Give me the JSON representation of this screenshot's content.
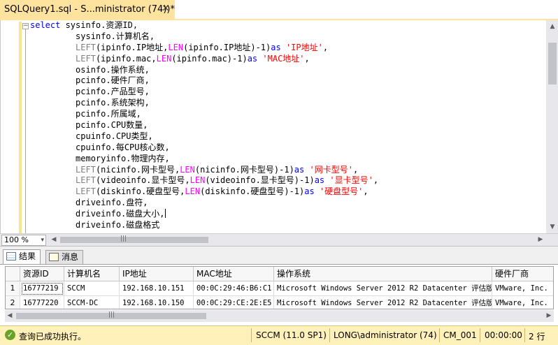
{
  "tab": {
    "title": "SQLQuery1.sql - S...ministrator (74))*",
    "close": "✕"
  },
  "editor": {
    "collapse": "−",
    "lines": [
      [
        [
          "kw",
          "select "
        ],
        [
          "",
          "sysinfo.资源ID,"
        ]
      ],
      [
        [
          "",
          "         sysinfo.计算机名,"
        ]
      ],
      [
        [
          "",
          "         "
        ],
        [
          "gray",
          "LEFT"
        ],
        [
          "",
          "(ipinfo.IP地址,"
        ],
        [
          "fn",
          "LEN"
        ],
        [
          "",
          "(ipinfo.IP地址)-1)"
        ],
        [
          "kw",
          "as "
        ],
        [
          "str",
          "'IP地址'"
        ],
        [
          "",
          ","
        ]
      ],
      [
        [
          "",
          "         "
        ],
        [
          "gray",
          "LEFT"
        ],
        [
          "",
          "(ipinfo.mac,"
        ],
        [
          "fn",
          "LEN"
        ],
        [
          "",
          "(ipinfo.mac)-1)"
        ],
        [
          "kw",
          "as "
        ],
        [
          "str",
          "'MAC地址'"
        ],
        [
          "",
          ","
        ]
      ],
      [
        [
          "",
          "         osinfo.操作系统,"
        ]
      ],
      [
        [
          "",
          "         pcinfo.硬件厂商,"
        ]
      ],
      [
        [
          "",
          "         pcinfo.产品型号,"
        ]
      ],
      [
        [
          "",
          "         pcinfo.系统架构,"
        ]
      ],
      [
        [
          "",
          "         pcinfo.所属域,"
        ]
      ],
      [
        [
          "",
          "         pcinfo.CPU数量,"
        ]
      ],
      [
        [
          "",
          "         cpuinfo.CPU类型,"
        ]
      ],
      [
        [
          "",
          "         cpuinfo.每CPU核心数,"
        ]
      ],
      [
        [
          "",
          "         memoryinfo.物理内存,"
        ]
      ],
      [
        [
          "",
          "         "
        ],
        [
          "gray",
          "LEFT"
        ],
        [
          "",
          "(nicinfo.网卡型号,"
        ],
        [
          "fn",
          "LEN"
        ],
        [
          "",
          "(nicinfo.网卡型号)-1)"
        ],
        [
          "kw",
          "as "
        ],
        [
          "str",
          "'网卡型号'"
        ],
        [
          "",
          ","
        ]
      ],
      [
        [
          "",
          "         "
        ],
        [
          "gray",
          "LEFT"
        ],
        [
          "",
          "(videoinfo.显卡型号,"
        ],
        [
          "fn",
          "LEN"
        ],
        [
          "",
          "(videoinfo.显卡型号)-1)"
        ],
        [
          "kw",
          "as "
        ],
        [
          "str",
          "'显卡型号'"
        ],
        [
          "",
          ","
        ]
      ],
      [
        [
          "",
          "         "
        ],
        [
          "gray",
          "LEFT"
        ],
        [
          "",
          "(diskinfo.硬盘型号,"
        ],
        [
          "fn",
          "LEN"
        ],
        [
          "",
          "(diskinfo.硬盘型号)-1)"
        ],
        [
          "kw",
          "as "
        ],
        [
          "str",
          "'硬盘型号'"
        ],
        [
          "",
          ","
        ]
      ],
      [
        [
          "",
          "         driveinfo.盘符,"
        ]
      ],
      [
        [
          "",
          "         driveinfo.磁盘大小,"
        ]
      ],
      [
        [
          "",
          "         driveinfo.磁盘格式"
        ]
      ]
    ],
    "caret_line": 17
  },
  "zoom": {
    "value": "100 %",
    "dropdown": "▾"
  },
  "results": {
    "tabs": [
      {
        "label": "结果",
        "active": true
      },
      {
        "label": "消息",
        "active": false
      }
    ],
    "columns": [
      "资源ID",
      "计算机名",
      "IP地址",
      "MAC地址",
      "操作系统",
      "硬件厂商"
    ],
    "rows": [
      {
        "num": "1",
        "cells": [
          "16777219",
          "SCCM",
          "192.168.10.151",
          "00:0C:29:46:B6:C1",
          "Microsoft Windows Server 2012 R2 Datacenter 评估版",
          "VMware, Inc."
        ]
      },
      {
        "num": "2",
        "cells": [
          "16777220",
          "SCCM-DC",
          "192.168.10.150",
          "00:0C:29:CE:2E:E5",
          "Microsoft Windows Server 2012 R2 Datacenter 评估版",
          "VMware, Inc."
        ]
      }
    ]
  },
  "status": {
    "message": "查询已成功执行。",
    "server": "SCCM (11.0 SP1)",
    "user": "LONG\\administrator (74)",
    "database": "CM_001",
    "elapsed": "00:00:00",
    "rows": "2 行"
  },
  "colors": {
    "tab_active": "#fde39e",
    "status_bar": "#fff1b9",
    "keyword": "#0000ff",
    "function": "#ff00ff",
    "string": "#ff0000"
  }
}
